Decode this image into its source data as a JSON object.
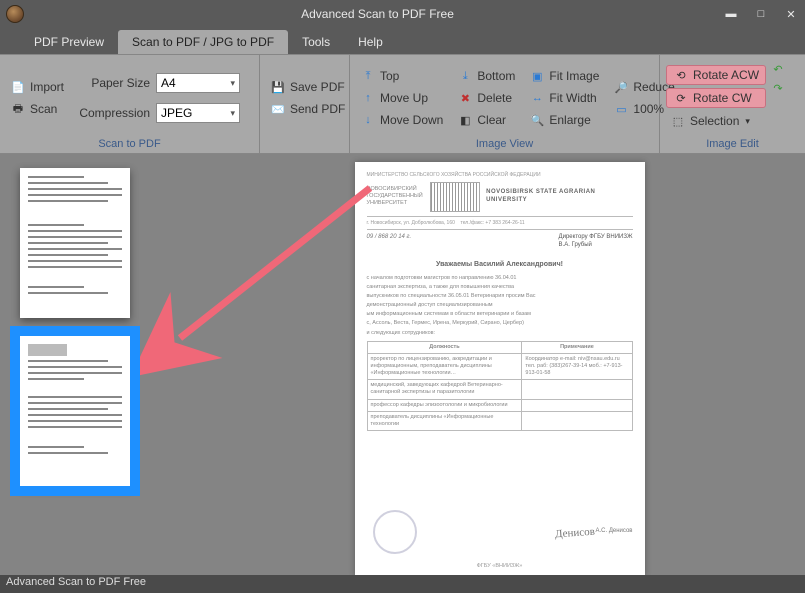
{
  "app": {
    "title": "Advanced Scan to PDF Free"
  },
  "tabs": {
    "pdf_preview": "PDF Preview",
    "scan_to_pdf": "Scan to PDF / JPG to PDF",
    "tools": "Tools",
    "help": "Help"
  },
  "ribbon": {
    "scan_group_label": "Scan to PDF",
    "image_view_label": "Image View",
    "image_edit_label": "Image Edit",
    "import": "Import",
    "scan": "Scan",
    "paper_size_label": "Paper Size",
    "paper_size_value": "A4",
    "compression_label": "Compression",
    "compression_value": "JPEG",
    "save_pdf": "Save PDF",
    "send_pdf": "Send PDF",
    "top": "Top",
    "move_up": "Move Up",
    "move_down": "Move Down",
    "bottom": "Bottom",
    "delete": "Delete",
    "clear": "Clear",
    "fit_image": "Fit Image",
    "fit_width": "Fit Width",
    "enlarge": "Enlarge",
    "reduce": "Reduce",
    "zoom_100": "100%",
    "rotate_acw": "Rotate ACW",
    "rotate_cw": "Rotate CW",
    "selection": "Selection"
  },
  "document": {
    "header_org": "МИНИСТЕРСТВО СЕЛЬСКОГО ХОЗЯЙСТВА РОССИЙСКОЙ ФЕДЕРАЦИИ",
    "uni_name": "NOVOSIBIRSK STATE AGRARIAN UNIVERSITY",
    "date_fragment": "09 / 868    20 14 г.",
    "addressee1": "Директору ФГБУ ВНИИЗЖ",
    "addressee2": "В.А. Грубый",
    "salutation": "Уважаемы Василий Александрович!",
    "body_lines": [
      "с началом подготовки магистров по направлению 36.04.01",
      "санитарная экспертиза, а также для повышения качества",
      "выпускников по специальности 36.05.01 Ветеринария просим Вас",
      "демонстрационный доступ специализированным",
      "ым информационным системам в области ветеринарии и базам",
      "с, Ассоль, Веста, Гермес, Ирена, Меркурий, Сирано, Цербер)",
      "и следующих сотрудников:"
    ],
    "table": {
      "h1": "Должность",
      "h2": "Примечание",
      "rows": [
        {
          "c1": "проректор по лицензированию, аккредитации и информационным, преподаватель дисциплины «Информационные технологии…",
          "c2": "Координатор e-mail: niv@nsau.edu.ru тел. раб: (383)267-39-14 моб.: +7-913-913-01-58"
        },
        {
          "c1": "медицинский, заведующих кафедрой Ветеринарно-санитарной экспертизы и паразитологии",
          "c2": ""
        },
        {
          "c1": "профессор кафедры эпизоотологии и микробиологии",
          "c2": ""
        },
        {
          "c1": "преподаватель дисциплины «Информационные технологии",
          "c2": ""
        }
      ]
    },
    "signatory": "А.С. Денисов",
    "footer": "ФГБУ «ВНИИЗЖ»"
  },
  "status": "Advanced Scan to PDF Free"
}
